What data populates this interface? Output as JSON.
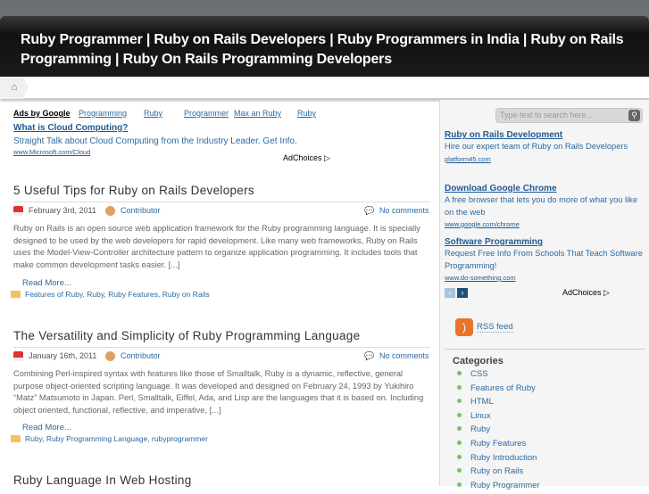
{
  "header": {
    "title": "Ruby Programmer | Ruby on Rails Developers | Ruby Programmers in India | Ruby on Rails Programming | Ruby On Rails Programming Developers",
    "home_icon": "home-icon"
  },
  "top_ads": {
    "label": "Ads by Google",
    "links": [
      "Programming",
      "Ruby",
      "Programmer",
      "Max an Ruby",
      "Ruby"
    ],
    "ad": {
      "title": "What is Cloud Computing?",
      "desc": "Straight Talk about Cloud Computing from the Industry Leader. Get Info.",
      "url": "www.Microsoft.com/Cloud"
    },
    "adchoices": "AdChoices ▷"
  },
  "posts": [
    {
      "title": "5 Useful Tips for Ruby on Rails Developers",
      "date": "February 3rd, 2011",
      "author": "Contributor",
      "comments": "No comments",
      "excerpt": "Ruby on Rails is an open source web application framework for the Ruby programming language. It is specially designed to be used by the web developers for rapid development. Like many web frameworks, Ruby on Rails uses the Model-View-Controller architecture pattern to organize application programming. It includes tools that make common development tasks easier. [...]",
      "read_more": "Read More...",
      "tags": "Features of Ruby, Ruby, Ruby Features, Ruby on Rails"
    },
    {
      "title": "The Versatility and Simplicity of Ruby Programming Language",
      "date": "January 16th, 2011",
      "author": "Contributor",
      "comments": "No comments",
      "excerpt": "Combining Perl-inspired syntax with features like those of Smalltalk, Ruby is a dynamic, reflective, general purpose object-oriented scripting language. It was developed and designed on February 24, 1993 by Yukihiro “Matz” Matsumoto in Japan. Perl, Smalltalk, Eiffel, Ada, and Lisp are the languages that it is based on. Including object oriented, functional, reflective, and imperative, [...]",
      "read_more": "Read More...",
      "tags": "Ruby, Ruby Programming Language, rubyprogrammer"
    },
    {
      "title": "Ruby Language In Web Hosting"
    }
  ],
  "sidebar": {
    "search_placeholder": "Type text to search here...",
    "ads": [
      {
        "title": "Ruby on Rails Development",
        "desc": "Hire our expert team of Ruby on Rails Developers",
        "url": "platform45.com"
      },
      {
        "title": "Download Google Chrome",
        "desc": "A free browser that lets you do more of what you like on the web",
        "url": "www.google.com/chrome"
      },
      {
        "title": "Software Programming",
        "desc": "Request Free Info From Schools That Teach Software Programming!",
        "url": "www.do-something.com"
      }
    ],
    "adchoices": "AdChoices ▷",
    "rss": "RSS feed",
    "categories_heading": "Categories",
    "categories": [
      "CSS",
      "Features of Ruby",
      "HTML",
      "Linux",
      "Ruby",
      "Ruby Features",
      "Ruby Introduction",
      "Ruby on Rails",
      "Ruby Programmer"
    ]
  }
}
